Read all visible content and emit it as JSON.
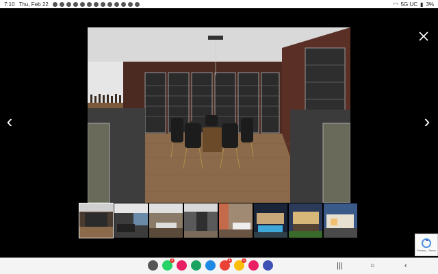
{
  "status": {
    "time": "7:10",
    "date": "Thu, Feb 22",
    "carrier": "5G UC",
    "battery": "3%"
  },
  "viewer": {
    "prev_glyph": "‹",
    "next_glyph": "›",
    "close_icon": "close-icon"
  },
  "thumbnails": [
    {
      "name": "wine-room",
      "active": true
    },
    {
      "name": "living-room",
      "active": false
    },
    {
      "name": "dining-room",
      "active": false
    },
    {
      "name": "hallway",
      "active": false
    },
    {
      "name": "kitchen",
      "active": false
    },
    {
      "name": "pool-night",
      "active": false
    },
    {
      "name": "house-exterior",
      "active": false
    },
    {
      "name": "facade-dusk",
      "active": false
    }
  ],
  "recaptcha": {
    "text": "Privacy - Terms"
  },
  "dock": {
    "apps": [
      {
        "name": "app-drawer-icon",
        "color": "#555555",
        "badge": ""
      },
      {
        "name": "whatsapp-icon",
        "color": "#25D366",
        "badge": "3"
      },
      {
        "name": "phone-app-icon",
        "color": "#e91e63",
        "badge": ""
      },
      {
        "name": "messages-icon",
        "color": "#1aa260",
        "badge": ""
      },
      {
        "name": "chat-icon",
        "color": "#1e88e5",
        "badge": ""
      },
      {
        "name": "gmail-icon",
        "color": "#ea4335",
        "badge": "1"
      },
      {
        "name": "chrome-icon",
        "color": "#fbbc05",
        "badge": "1"
      },
      {
        "name": "flower-app-icon",
        "color": "#e91e63",
        "badge": ""
      },
      {
        "name": "settings-icon",
        "color": "#3f51b5",
        "badge": ""
      }
    ],
    "recents_glyph": "|||",
    "home_glyph": "○",
    "back_glyph": "‹"
  },
  "colors": {
    "accent": "#ffffff",
    "background": "#000000"
  }
}
